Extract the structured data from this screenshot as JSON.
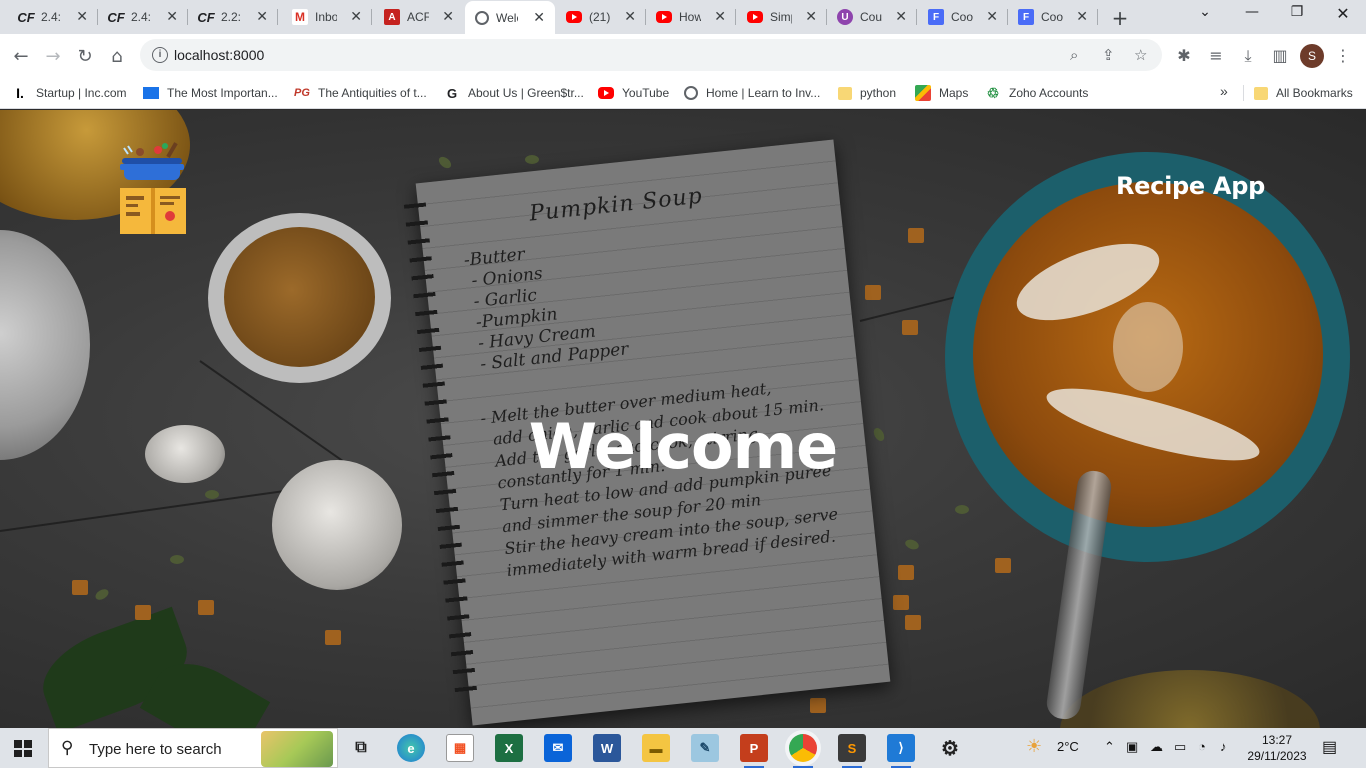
{
  "browser": {
    "tabs": [
      {
        "title": "2.4:",
        "favicon": "codeforces-icon"
      },
      {
        "title": "2.4:",
        "favicon": "codeforces-icon"
      },
      {
        "title": "2.2:",
        "favicon": "codeforces-icon"
      },
      {
        "title": "Inbo",
        "favicon": "gmail-icon"
      },
      {
        "title": "ACF",
        "favicon": "pdf-icon"
      },
      {
        "title": "Welc",
        "favicon": "globe-icon",
        "active": true
      },
      {
        "title": "(21)",
        "favicon": "youtube-icon"
      },
      {
        "title": "How",
        "favicon": "youtube-icon"
      },
      {
        "title": "Simp",
        "favicon": "youtube-icon"
      },
      {
        "title": "Cou",
        "favicon": "udemy-icon"
      },
      {
        "title": "Coo",
        "favicon": "forms-icon"
      },
      {
        "title": "Coo",
        "favicon": "forms-icon"
      }
    ],
    "url": "localhost:8000",
    "profile_initial": "S",
    "bookmarks": [
      {
        "label": "Startup | Inc.com",
        "icon": "inc-icon"
      },
      {
        "label": "The Most Importan...",
        "icon": "page-icon"
      },
      {
        "label": "The Antiquities of t...",
        "icon": "pg-icon"
      },
      {
        "label": "About Us | Green$tr...",
        "icon": "google-icon"
      },
      {
        "label": "YouTube",
        "icon": "youtube-icon"
      },
      {
        "label": "Home | Learn to Inv...",
        "icon": "globe-icon"
      },
      {
        "label": "python",
        "icon": "folder-icon"
      },
      {
        "label": "Maps",
        "icon": "maps-icon"
      },
      {
        "label": "Zoho Accounts",
        "icon": "zoho-icon"
      }
    ],
    "bookmarks_more": "»",
    "all_bookmarks": "All Bookmarks"
  },
  "page": {
    "app_title": "Recipe App",
    "hero_title": "Welcome",
    "notebook": {
      "title": "Pumpkin Soup",
      "ingredients": "-Butter\n - Onions\n - Garlic\n -Pumpkin\n - Havy Cream\n - Salt and Papper",
      "steps": "- Melt the butter over medium heat,\n  add onion, garlic and cook about 15 min.\n  Add the garlic and cook, stirring\n  constantly for 1 min.\n  Turn heat to low and add pumpkin puree\n  and simmer the soup for 20 min\n  Stir the heavy cream into the soup, serve\n  immediately with warm bread if desired."
    }
  },
  "taskbar": {
    "search_placeholder": "Type here to search",
    "apps": [
      "task-view-icon",
      "edge-icon",
      "store-icon",
      "excel-icon",
      "mail-icon",
      "word-icon",
      "file-explorer-icon",
      "notes-icon",
      "powerpoint-icon",
      "chrome-icon",
      "sublime-icon",
      "vscode-icon",
      "settings-icon"
    ],
    "weather": "2°C",
    "time": "13:27",
    "date": "29/11/2023"
  }
}
